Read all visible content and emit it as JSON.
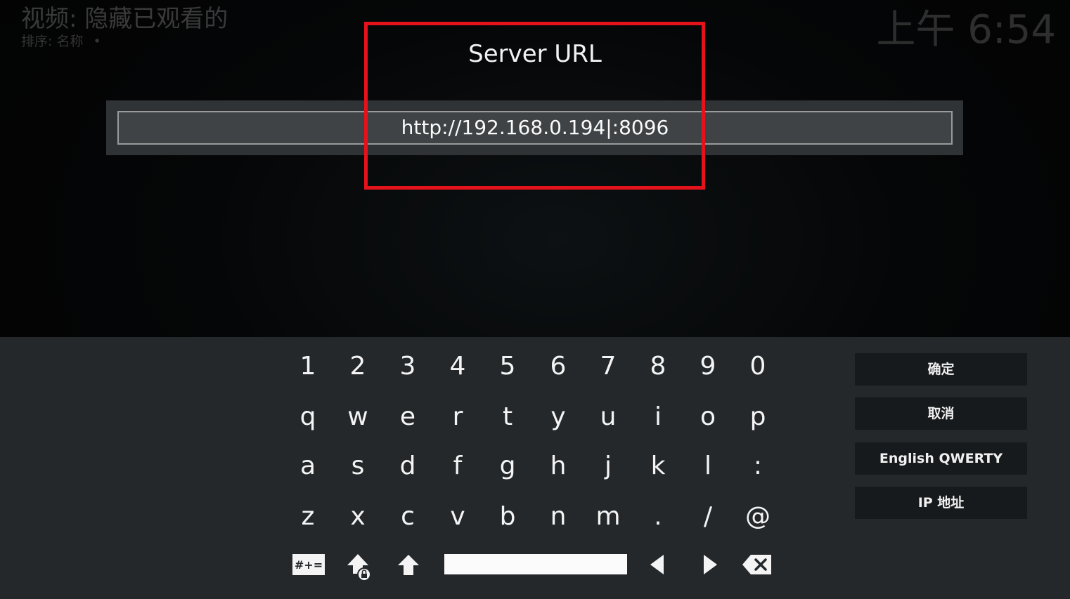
{
  "background": {
    "title": "视频: 隐藏已观看的",
    "sort_label": "排序: 名称",
    "sort_dot": "•",
    "clock": "上午 6:54"
  },
  "dialog": {
    "title": "Server URL",
    "input_value": "http://192.168.0.194|:8096",
    "highlight_color": "#e3121b"
  },
  "keyboard": {
    "rows": [
      [
        "1",
        "2",
        "3",
        "4",
        "5",
        "6",
        "7",
        "8",
        "9",
        "0"
      ],
      [
        "q",
        "w",
        "e",
        "r",
        "t",
        "y",
        "u",
        "i",
        "o",
        "p"
      ],
      [
        "a",
        "s",
        "d",
        "f",
        "g",
        "h",
        "j",
        "k",
        "l",
        ":"
      ],
      [
        "z",
        "x",
        "c",
        "v",
        "b",
        "n",
        "m",
        ".",
        "/",
        "@"
      ]
    ],
    "symbols_label": "#+=",
    "special_keys": [
      "symbols-icon",
      "shift-lock-icon",
      "shift-icon",
      "space-bar",
      "arrow-left-icon",
      "arrow-right-icon",
      "backspace-icon"
    ]
  },
  "side_buttons": {
    "ok": "确定",
    "cancel": "取消",
    "layout": "English QWERTY",
    "ip_address": "IP 地址"
  }
}
